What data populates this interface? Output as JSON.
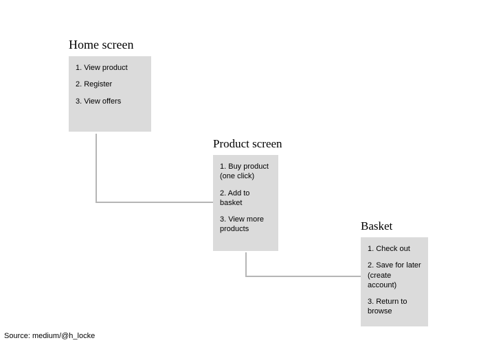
{
  "nodes": [
    {
      "title": "Home screen",
      "items": [
        "1. View product",
        "2. Register",
        "3. View offers"
      ]
    },
    {
      "title": "Product screen",
      "items": [
        "1. Buy product (one click)",
        "2. Add to basket",
        "3. View more products"
      ]
    },
    {
      "title": "Basket",
      "items": [
        "1. Check out",
        "2. Save for later (create account)",
        "3. Return to browse"
      ]
    }
  ],
  "source": "Source: medium/@h_locke"
}
